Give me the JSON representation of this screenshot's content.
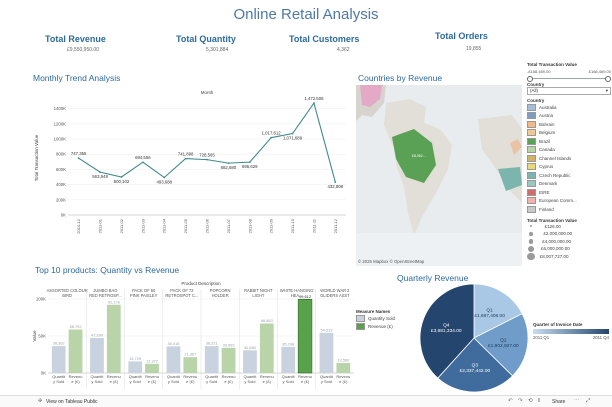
{
  "dashboard": {
    "title": "Online Retail Analysis"
  },
  "kpis": [
    {
      "label": "Total Revenue",
      "value": "£9,550,950.00"
    },
    {
      "label": "Total Quantity",
      "value": "5,301,884"
    },
    {
      "label": "Total Customers",
      "value": "4,362"
    },
    {
      "label": "Total Orders",
      "value": "19,855"
    }
  ],
  "monthly": {
    "title": "Monthly Trend Analysis",
    "header": "Month",
    "ylabel": "Total Transaction Value"
  },
  "map": {
    "title": "Countries by Revenue",
    "label": "£8,052...",
    "attribution": "© 2025 Mapbox © OpenStreetMap"
  },
  "filters": {
    "range_title": "Total Transaction Value",
    "range_min": "-£168,469.00",
    "range_max": "£168,469.00",
    "country_title": "Country",
    "country_value": "(All)",
    "country_list_title": "Country",
    "countries": [
      {
        "name": "Australia",
        "color": "#a7bcd7"
      },
      {
        "name": "Austria",
        "color": "#7f9cc0"
      },
      {
        "name": "Bahrain",
        "color": "#f0b989"
      },
      {
        "name": "Belgium",
        "color": "#efc895"
      },
      {
        "name": "Brazil",
        "color": "#5aa155"
      },
      {
        "name": "Canada",
        "color": "#b6d4a6"
      },
      {
        "name": "Channel Islands",
        "color": "#cdb46a"
      },
      {
        "name": "Cyprus",
        "color": "#e8d77c"
      },
      {
        "name": "Czech Republic",
        "color": "#7bb5ad"
      },
      {
        "name": "Denmark",
        "color": "#9bc5c0"
      },
      {
        "name": "EIRE",
        "color": "#d16d6d"
      },
      {
        "name": "European Comm...",
        "color": "#f0b4ad"
      },
      {
        "name": "Finland",
        "color": "#c9c9c9"
      }
    ],
    "size_title": "Total Transaction Value",
    "sizes": [
      "£126.00",
      "£2,000,000.00",
      "£4,000,000.00",
      "£6,000,000.00",
      "£8,007,727.00"
    ]
  },
  "products": {
    "title": "Top 10 products: Quantity vs Revenue",
    "header": "Product Description",
    "ylabel": "Value",
    "names": [
      "ASSORTED COLOUR BIRD",
      "JUMBO BAG RED RETROSP...",
      "PACK OF 60 PINK PAISLEY",
      "PACK OF 72 RETROSPOT C...",
      "POPCORN HOLDER",
      "RABBIT NIGHT LIGHT",
      "WHITE HANGING HEA...",
      "WORLD WAR 2 GLIDERS ASST"
    ],
    "x_labels": [
      "Quantit y Sold",
      "Revenu e (£)"
    ],
    "legend_title": "Measure Names",
    "legend": [
      {
        "name": "Quantity Sold",
        "color": "#c9d3df"
      },
      {
        "name": "Revenue (£)",
        "color": "#5aa14b"
      }
    ]
  },
  "quarterly": {
    "title": "Quarterly Revenue",
    "legend_title": "Quarter of Invoice Date",
    "legend_min": "2011 Q1",
    "legend_max": "2011 Q4"
  },
  "footer": {
    "link": "View on Tableau Public",
    "share": "Share"
  },
  "chart_data": [
    {
      "type": "line",
      "title": "Monthly Trend Analysis",
      "xlabel": "Month",
      "ylabel": "Total Transaction Value",
      "x": [
        "2010-12",
        "2011-01",
        "2011-02",
        "2011-03",
        "2011-04",
        "2011-05",
        "2011-06",
        "2011-07",
        "2011-08",
        "2011-09",
        "2011-10",
        "2011-11",
        "2011-12"
      ],
      "values": [
        747355,
        563949,
        500102,
        694556,
        493688,
        741898,
        728561,
        682680,
        695629,
        1017612,
        1071689,
        1472506,
        432808
      ],
      "labels": [
        "747,355",
        "563,949",
        "500,102",
        "694,556",
        "493,688",
        "741,898",
        "728,565",
        "682,680",
        "695,629",
        "1,017,612",
        "1,071,689",
        "1,472,506",
        "432,808"
      ],
      "ylim": [
        0,
        1500000
      ],
      "yticks": [
        0,
        200000,
        400000,
        600000,
        800000,
        1000000,
        1200000,
        1400000
      ],
      "ytick_labels": [
        "0K",
        "200K",
        "400K",
        "600K",
        "800K",
        "1000K",
        "1200K",
        "1400K"
      ],
      "color": "#3f8a8f"
    },
    {
      "type": "bar",
      "title": "Top 10 products: Quantity vs Revenue",
      "ylabel": "Value",
      "groups": [
        "ASSORTED COLOUR BIRD",
        "JUMBO BAG RED RETROSP...",
        "PACK OF 60 PINK PAISLEY",
        "PACK OF 72 RETROSPOT C...",
        "POPCORN HOLDER",
        "RABBIT NIGHT LIGHT",
        "WHITE HANGING HEA...",
        "WORLD WAR 2 GLIDERS ASST"
      ],
      "series": [
        {
          "name": "Quantity Sold",
          "values": [
            36362,
            47260,
            15729,
            36016,
            36321,
            30680,
            35298,
            54319
          ],
          "labels": [
            "36,362",
            "47,260",
            "15,729",
            "36,016",
            "36,321",
            "30,680",
            "35,298",
            "54,319"
          ]
        },
        {
          "name": "Revenue (£)",
          "values": [
            58792,
            92176,
            12372,
            21367,
            33969,
            66863,
            99612,
            13560
          ],
          "labels": [
            "58,792",
            "92,176",
            "12,372",
            "21,367",
            "33,969",
            "66,863",
            "99,612",
            "13,560"
          ]
        }
      ],
      "ylim": [
        0,
        100000
      ],
      "yticks": [
        0,
        50000,
        100000
      ],
      "ytick_labels": [
        "0K",
        "50K",
        "100K"
      ]
    },
    {
      "type": "pie",
      "title": "Quarterly Revenue",
      "categories": [
        "Q1",
        "Q2",
        "Q3",
        "Q4"
      ],
      "values": [
        1687408,
        1902927,
        2337442,
        3681334
      ],
      "labels": [
        [
          "Q1",
          "£1,687,408.00"
        ],
        [
          "Q2",
          "£1,902,927.00"
        ],
        [
          "Q3",
          "£2,337,442.00"
        ],
        [
          "Q4",
          "£3,681,334.00"
        ]
      ],
      "colors": [
        "#a8c8e6",
        "#6f9cc9",
        "#3f6c9c",
        "#24456d"
      ],
      "label_colors": [
        "#1f3a5a",
        "#1f3a5a",
        "#ffffff",
        "#ffffff"
      ]
    }
  ]
}
